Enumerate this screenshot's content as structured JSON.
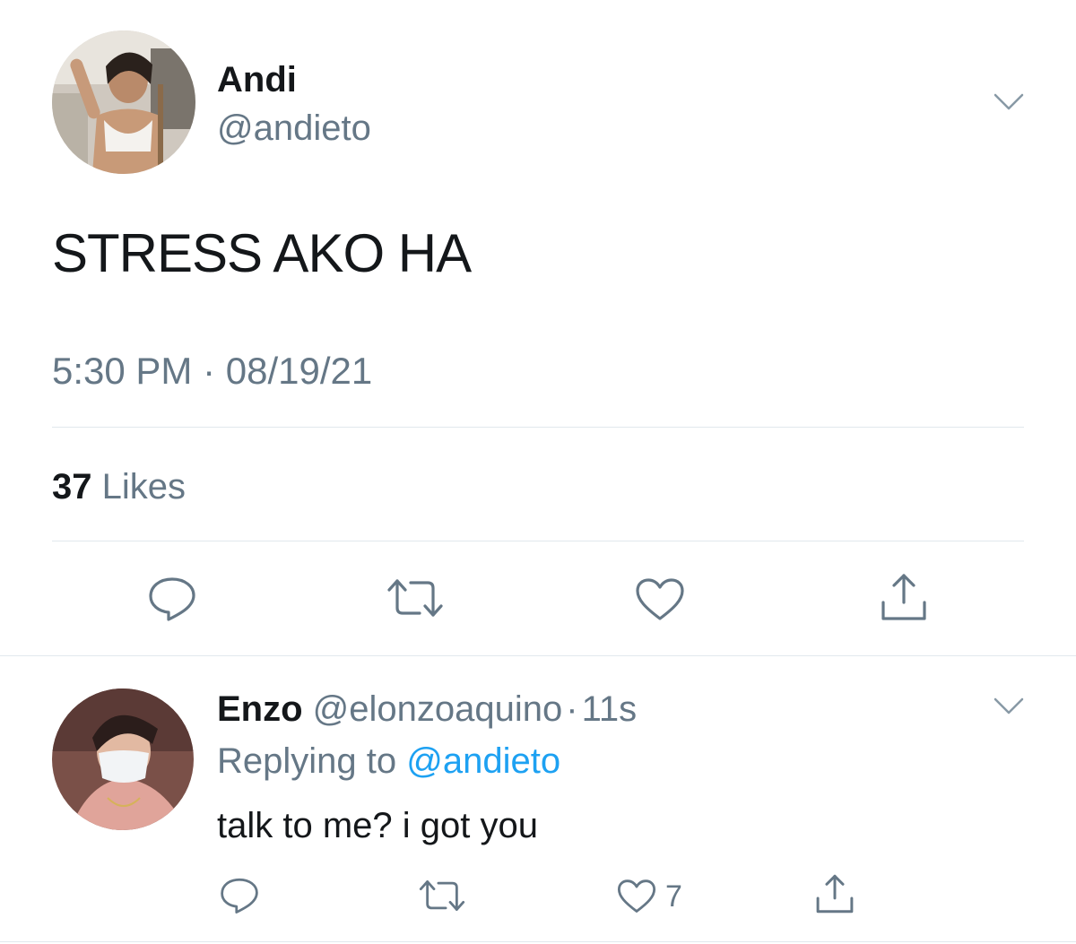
{
  "tweet": {
    "author_name": "Andi",
    "author_handle": "@andieto",
    "text": "STRESS AKO HA",
    "timestamp": "5:30 PM · 08/19/21",
    "likes_count": "37",
    "likes_label": "Likes"
  },
  "reply": {
    "author_name": "Enzo",
    "author_handle": "@elonzoaquino",
    "separator": "·",
    "time_ago": "11s",
    "replying_prefix": "Replying to",
    "replying_handle": "@andieto",
    "text": "talk to me? i got you",
    "like_count": "7"
  },
  "colors": {
    "text": "#14171a",
    "secondary": "#657786",
    "link": "#1da1f2",
    "divider": "#e1e8ed"
  },
  "icons": [
    "reply-icon",
    "retweet-icon",
    "like-icon",
    "share-icon",
    "chevron-down-icon"
  ]
}
